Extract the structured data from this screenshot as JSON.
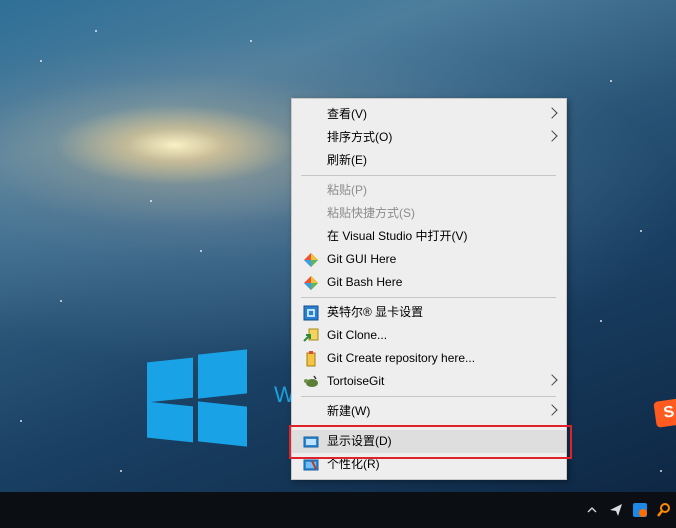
{
  "context_menu": {
    "items": [
      {
        "label": "查看(V)",
        "submenu": true
      },
      {
        "label": "排序方式(O)",
        "submenu": true
      },
      {
        "label": "刷新(E)"
      },
      {
        "label": "粘贴(P)",
        "disabled": true
      },
      {
        "label": "粘贴快捷方式(S)",
        "disabled": true
      },
      {
        "label": "在 Visual Studio 中打开(V)"
      },
      {
        "label": "Git GUI Here",
        "icon": "git-diamond-icon"
      },
      {
        "label": "Git Bash Here",
        "icon": "git-diamond-icon"
      },
      {
        "label": "英特尔® 显卡设置",
        "icon": "intel-graphics-icon"
      },
      {
        "label": "Git Clone...",
        "icon": "git-clone-icon"
      },
      {
        "label": "Git Create repository here...",
        "icon": "git-create-repo-icon"
      },
      {
        "label": "TortoiseGit",
        "icon": "tortoisegit-icon",
        "submenu": true
      },
      {
        "label": "新建(W)",
        "submenu": true
      },
      {
        "label": "显示设置(D)",
        "icon": "display-settings-icon",
        "highlighted": true
      },
      {
        "label": "个性化(R)",
        "icon": "personalize-icon"
      }
    ]
  },
  "desktop": {
    "windows_text": "W",
    "sogou_logo": "S"
  },
  "taskbar": {
    "tray_icons": [
      "chevron-up-icon",
      "send-icon",
      "ime-icon",
      "search-icon"
    ]
  },
  "colors": {
    "highlight_box": "#e0222a",
    "windows_blue": "#19a3e6"
  }
}
